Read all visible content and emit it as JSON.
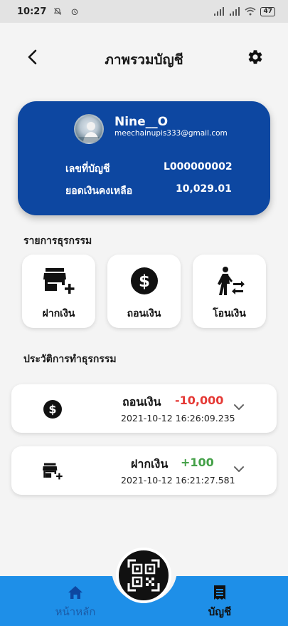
{
  "status_bar": {
    "time": "10:27",
    "battery": "47"
  },
  "header": {
    "title": "ภาพรวมบัญชี",
    "back_icon": "chevron-left-icon",
    "settings_icon": "gear-icon"
  },
  "account": {
    "name": "Nine__O",
    "email": "meechainupis333@gmail.com",
    "account_no_label": "เลขที่บัญชี",
    "account_no": "L000000002",
    "balance_label": "ยอดเงินคงเหลือ",
    "balance": "10,029.01",
    "card_color": "#0d47a1"
  },
  "transactions_section": {
    "title": "รายการธุรกรรม",
    "actions": [
      {
        "label": "ฝากเงิน",
        "icon": "store-plus-icon"
      },
      {
        "label": "ถอนเงิน",
        "icon": "dollar-coin-icon"
      },
      {
        "label": "โอนเงิน",
        "icon": "person-transfer-icon"
      }
    ]
  },
  "history_section": {
    "title": "ประวัติการทำธุรกรรม",
    "items": [
      {
        "type": "ถอนเงิน",
        "amount": "-10,000",
        "amount_color": "#e53935",
        "time": "2021-10-12 16:26:09.235",
        "icon": "dollar-coin-icon"
      },
      {
        "type": "ฝากเงิน",
        "amount": "+100",
        "amount_color": "#43a047",
        "time": "2021-10-12 16:21:27.581",
        "icon": "store-plus-icon"
      }
    ]
  },
  "bottom_nav": {
    "home_label": "หน้าหลัก",
    "account_label": "บัญชี",
    "bar_color": "#1e8fe8",
    "qr_icon": "qr-code-icon"
  }
}
